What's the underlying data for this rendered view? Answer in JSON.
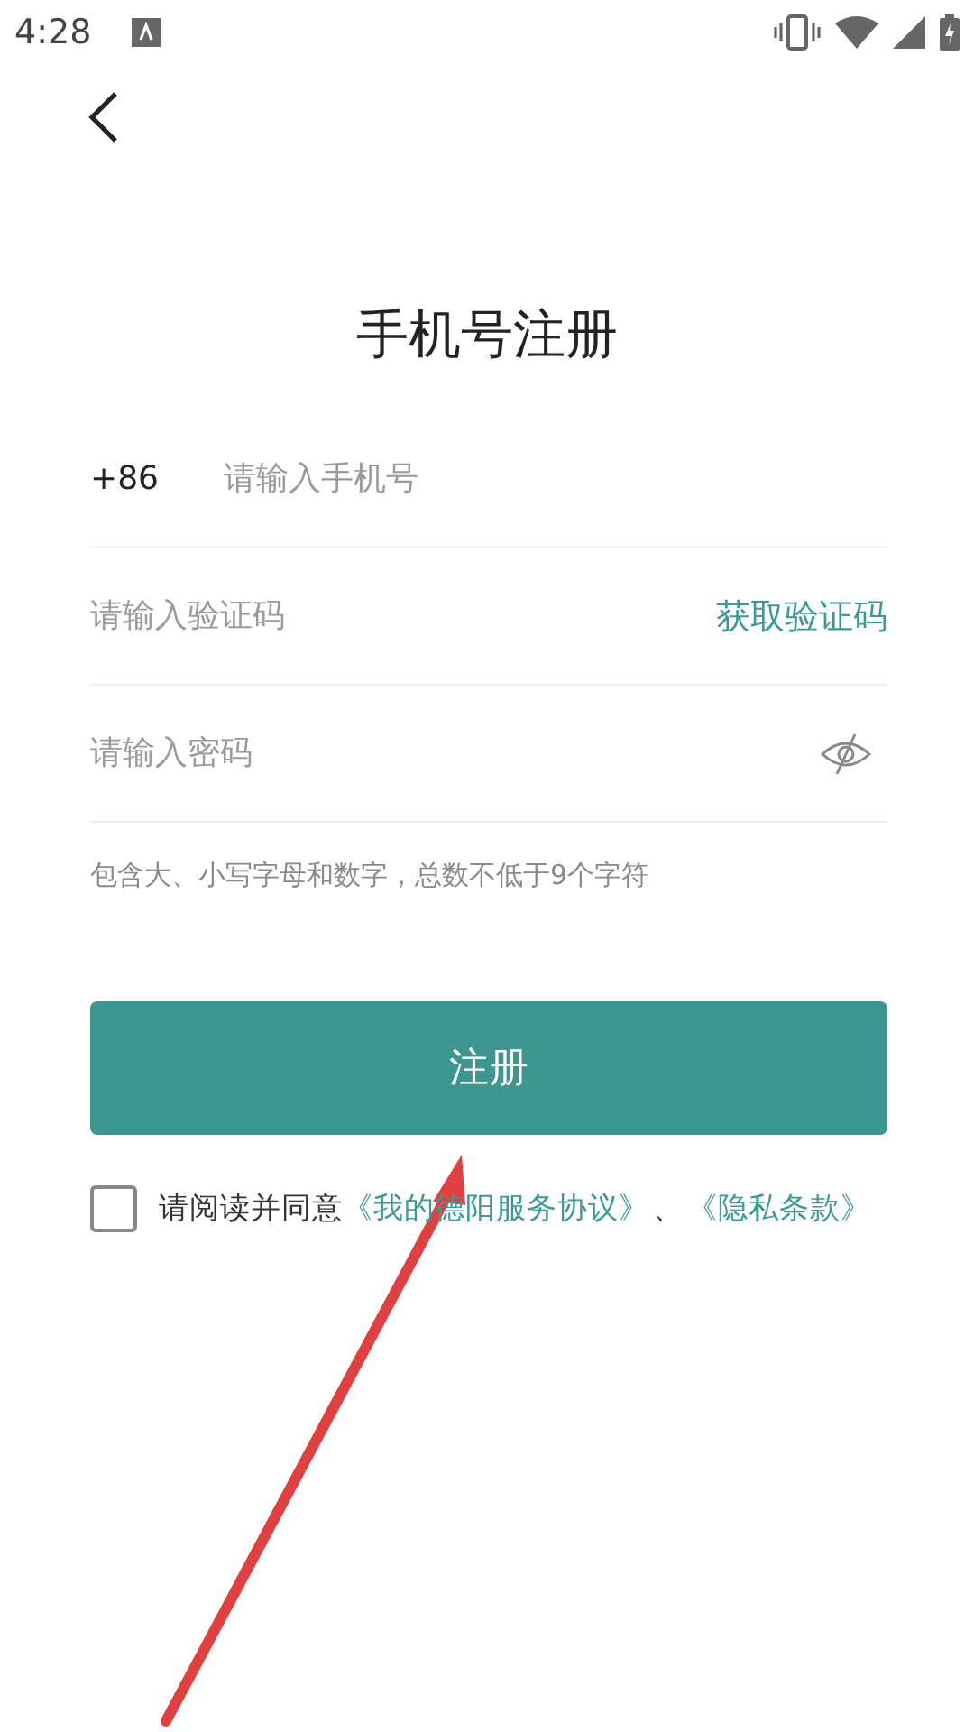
{
  "status_bar": {
    "time": "4:28"
  },
  "title": "手机号注册",
  "phone": {
    "prefix": "+86",
    "placeholder": "请输入手机号"
  },
  "code": {
    "placeholder": "请输入验证码",
    "action": "获取验证码"
  },
  "password": {
    "placeholder": "请输入密码",
    "visible": false
  },
  "hint": "包含大、小写字母和数字，总数不低于9个字符",
  "submit": "注册",
  "agreement": {
    "checked": false,
    "text": "请阅读并同意",
    "links": [
      "《我的德阳服务协议》",
      "《隐私条款》"
    ],
    "separator": "、"
  }
}
